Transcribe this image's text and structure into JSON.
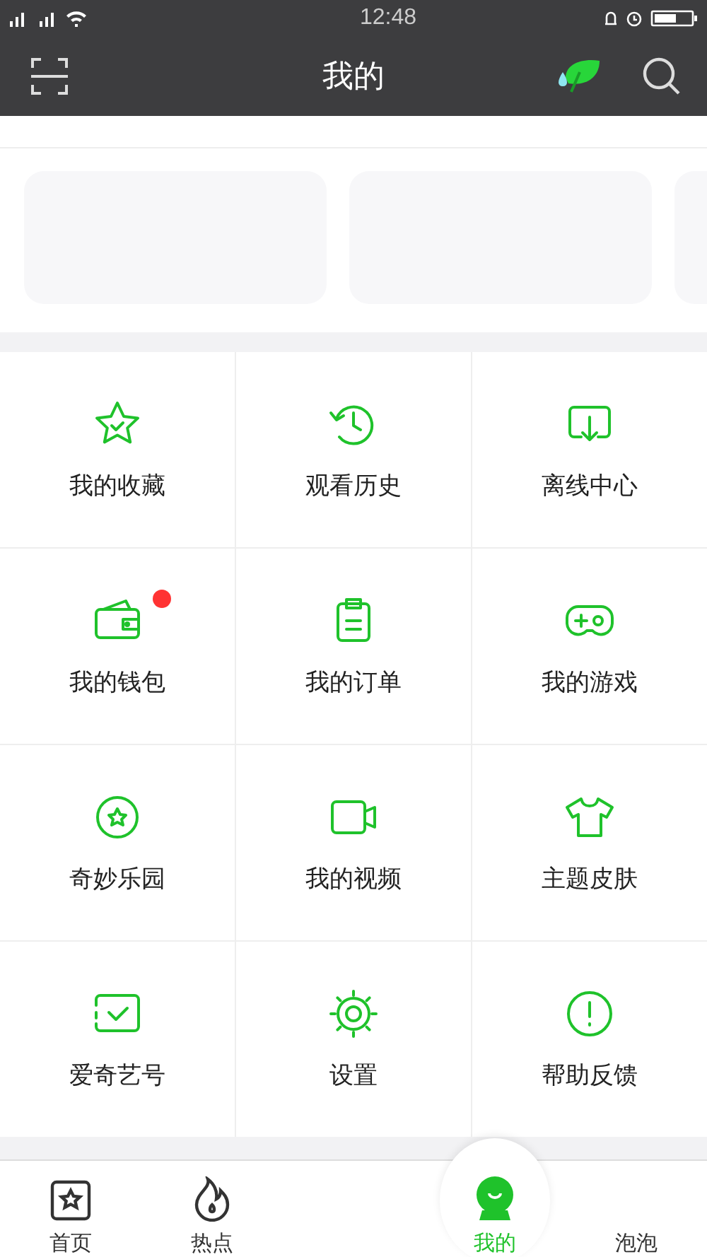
{
  "status_bar": {
    "time": "12:48"
  },
  "header": {
    "title": "我的"
  },
  "bubble_section": {
    "cards": [
      {
        "kind": "card"
      },
      {
        "kind": "card"
      },
      {
        "kind": "card"
      }
    ]
  },
  "grid": [
    {
      "label": "我的收藏",
      "badge": false
    },
    {
      "label": "观看历史",
      "badge": false
    },
    {
      "label": "离线中心",
      "badge": false
    },
    {
      "label": "我的钱包",
      "badge": true
    },
    {
      "label": "我的订单",
      "badge": false
    },
    {
      "label": "我的游戏",
      "badge": false
    },
    {
      "label": "奇妙乐园",
      "badge": false
    },
    {
      "label": "我的视频",
      "badge": false
    },
    {
      "label": "主题皮肤",
      "badge": false
    },
    {
      "label": "爱奇艺号",
      "badge": false
    },
    {
      "label": "设置",
      "badge": false
    },
    {
      "label": "帮助反馈",
      "badge": false
    }
  ],
  "nav": [
    {
      "label": "首页",
      "selected": false
    },
    {
      "label": "热点",
      "selected": false
    },
    {
      "label": "我的",
      "selected": true
    },
    {
      "label": "泡泡",
      "selected": false
    }
  ]
}
